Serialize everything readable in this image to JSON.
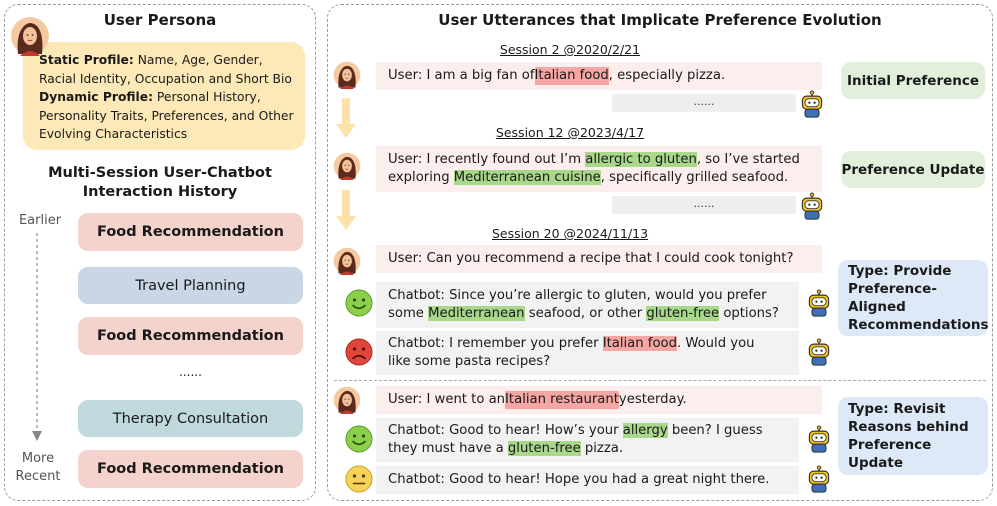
{
  "left": {
    "title": "User Persona",
    "static_label": "Static Profile:",
    "static_text": " Name, Age, Gender, Racial Identity, Occupation and Short Bio",
    "dynamic_label": "Dynamic Profile:",
    "dynamic_text": " Personal History, Personality Traits, Preferences, and Other Evolving Characteristics",
    "history_title_1": "Multi-Session User-Chatbot",
    "history_title_2": "Interaction History",
    "earlier": "Earlier",
    "more": "More",
    "recent": "Recent",
    "sessions": [
      "Food Recommendation",
      "Travel Planning",
      "Food Recommendation",
      "......",
      "Therapy Consultation",
      "Food Recommendation"
    ]
  },
  "right": {
    "title": "User Utterances that Implicate Preference Evolution",
    "s1_label": "Session 2 @2020/2/21",
    "s1_user_a": "User: I am a big fan of ",
    "s1_user_hl": "Italian food",
    "s1_user_b": ", especially pizza.",
    "s1_dots": "......",
    "tag_initial": "Initial Preference",
    "s2_label": "Session 12 @2023/4/17",
    "s2_a": "User: I recently found out I’m ",
    "s2_hl1": "allergic to gluten",
    "s2_b": ", so I’ve started",
    "s2_hl2": "Mediterranean cuisine",
    "s2_pre2": "exploring ",
    "s2_c": ", specifically grilled seafood.",
    "s2_dots": "......",
    "tag_update": "Preference Update",
    "s3_label": "Session 20 @2024/11/13",
    "s3_user": "User: Can you recommend a recipe that I could cook tonight?",
    "s3_bot1_a": "Chatbot: Since you’re allergic to gluten, would you prefer",
    "s3_bot1_b": "some ",
    "s3_bot1_hl1": "Mediterranean",
    "s3_bot1_c": " seafood, or other ",
    "s3_bot1_hl2": "gluten-free",
    "s3_bot1_d": " options?",
    "s3_bot2_a": "Chatbot: I remember you prefer ",
    "s3_bot2_hl": "Italian food",
    "s3_bot2_b": ". Would you",
    "s3_bot2_c": "like some pasta recipes?",
    "tag_type1_a": "Type: Provide",
    "tag_type1_b": "Preference-Aligned",
    "tag_type1_c": "Recommendations",
    "s4_user_a": "User: I went to an ",
    "s4_user_hl": "Italian restaurant",
    "s4_user_b": " yesterday.",
    "s4_bot1_a": "Chatbot: Good to hear! How’s your ",
    "s4_bot1_hl1": "allergy",
    "s4_bot1_b": " been? I guess",
    "s4_bot1_c": "they must have a ",
    "s4_bot1_hl2": "gluten-free",
    "s4_bot1_d": " pizza.",
    "s4_bot2": "Chatbot: Good to hear! Hope you had a great night there.",
    "tag_type2_a": "Type: Revisit",
    "tag_type2_b": "Reasons behind",
    "tag_type2_c": "Preference Update"
  }
}
